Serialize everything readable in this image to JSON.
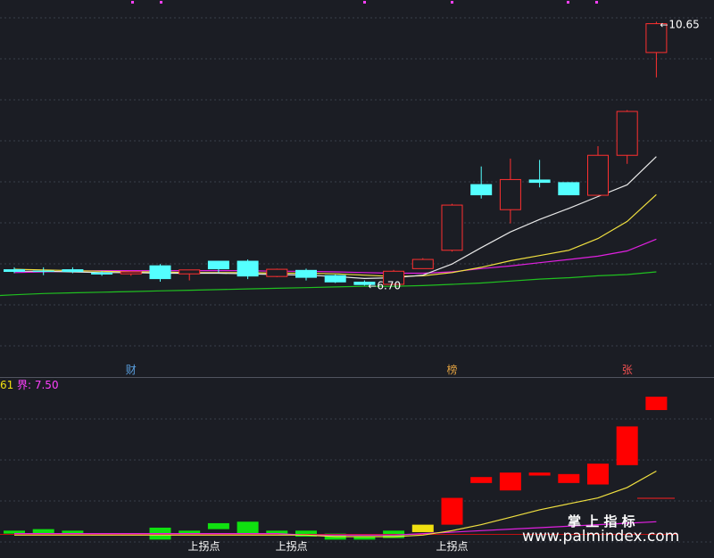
{
  "chart_data": [
    {
      "type": "candlestick",
      "title": "",
      "ylim": [
        6.0,
        10.9
      ],
      "candles": [
        {
          "o": 6.87,
          "h": 6.9,
          "l": 6.81,
          "c": 6.83
        },
        {
          "o": 6.85,
          "h": 6.9,
          "l": 6.78,
          "c": 6.83
        },
        {
          "o": 6.87,
          "h": 6.9,
          "l": 6.81,
          "c": 6.83
        },
        {
          "o": 6.82,
          "h": 6.84,
          "l": 6.77,
          "c": 6.79
        },
        {
          "o": 6.8,
          "h": 6.84,
          "l": 6.77,
          "c": 6.83
        },
        {
          "o": 6.93,
          "h": 6.95,
          "l": 6.68,
          "c": 6.72
        },
        {
          "o": 6.8,
          "h": 6.84,
          "l": 6.7,
          "c": 6.86
        },
        {
          "o": 7.0,
          "h": 7.0,
          "l": 6.82,
          "c": 6.87
        },
        {
          "o": 7.0,
          "h": 7.02,
          "l": 6.72,
          "c": 6.76
        },
        {
          "o": 6.76,
          "h": 6.88,
          "l": 6.75,
          "c": 6.87
        },
        {
          "o": 6.86,
          "h": 6.88,
          "l": 6.7,
          "c": 6.74
        },
        {
          "o": 6.78,
          "h": 6.79,
          "l": 6.66,
          "c": 6.67
        },
        {
          "o": 6.68,
          "h": 6.7,
          "l": 6.62,
          "c": 6.63
        },
        {
          "o": 6.64,
          "h": 6.86,
          "l": 6.64,
          "c": 6.84
        },
        {
          "o": 6.88,
          "h": 7.04,
          "l": 6.88,
          "c": 7.02
        },
        {
          "o": 7.16,
          "h": 7.87,
          "l": 7.14,
          "c": 7.85
        },
        {
          "o": 8.17,
          "h": 8.44,
          "l": 7.95,
          "c": 8.0
        },
        {
          "o": 7.78,
          "h": 8.56,
          "l": 7.57,
          "c": 8.24
        },
        {
          "o": 8.24,
          "h": 8.54,
          "l": 8.12,
          "c": 8.19
        },
        {
          "o": 8.2,
          "h": 8.2,
          "l": 8.0,
          "c": 8.0
        },
        {
          "o": 8.0,
          "h": 8.75,
          "l": 8.0,
          "c": 8.61
        },
        {
          "o": 8.61,
          "h": 9.3,
          "l": 8.48,
          "c": 9.28
        },
        {
          "o": 10.18,
          "h": 10.65,
          "l": 9.8,
          "c": 10.62
        }
      ],
      "ma_white": [
        6.84,
        6.84,
        6.83,
        6.82,
        6.82,
        6.81,
        6.81,
        6.81,
        6.8,
        6.79,
        6.78,
        6.76,
        6.73,
        6.74,
        6.78,
        6.95,
        7.2,
        7.44,
        7.63,
        7.8,
        7.98,
        8.16,
        8.59
      ],
      "ma_yellow": [
        6.87,
        6.86,
        6.85,
        6.84,
        6.83,
        6.83,
        6.82,
        6.82,
        6.82,
        6.81,
        6.81,
        6.8,
        6.78,
        6.76,
        6.77,
        6.82,
        6.9,
        7.0,
        7.08,
        7.16,
        7.34,
        7.6,
        8.01
      ],
      "ma_magenta": [
        6.82,
        6.83,
        6.84,
        6.85,
        6.85,
        6.85,
        6.85,
        6.85,
        6.85,
        6.84,
        6.84,
        6.83,
        6.82,
        6.81,
        6.81,
        6.83,
        6.88,
        6.92,
        6.97,
        7.02,
        7.07,
        7.15,
        7.33
      ],
      "ma_green": [
        6.48,
        6.5,
        6.51,
        6.52,
        6.53,
        6.54,
        6.55,
        6.56,
        6.57,
        6.58,
        6.59,
        6.6,
        6.61,
        6.61,
        6.62,
        6.64,
        6.66,
        6.69,
        6.72,
        6.74,
        6.77,
        6.79,
        6.83
      ],
      "price_labels": [
        {
          "index": 22,
          "value": 10.65,
          "text": "10.65"
        },
        {
          "index": 12,
          "value": 6.62,
          "text": "6.70"
        }
      ],
      "markers": [
        {
          "index": 4,
          "text": "财",
          "color": "#5aa0e0"
        },
        {
          "index": 15,
          "text": "榜",
          "color": "#e0a040"
        },
        {
          "index": 21,
          "text": "张",
          "color": "#f05050"
        }
      ]
    },
    {
      "type": "bar",
      "header_left": "61",
      "header_value": "界: 7.50",
      "ylim": [
        0,
        1
      ],
      "bars": [
        {
          "top": 0.1,
          "bottom": 0.08,
          "color": "#10e010"
        },
        {
          "top": 0.11,
          "bottom": 0.08,
          "color": "#10e010"
        },
        {
          "top": 0.1,
          "bottom": 0.08,
          "color": "#10e010"
        },
        {
          "top": 0.08,
          "bottom": 0.07,
          "color": "#10e010"
        },
        {
          "top": 0.08,
          "bottom": 0.07,
          "color": "#10e010"
        },
        {
          "top": 0.12,
          "bottom": 0.04,
          "color": "#10e010"
        },
        {
          "top": 0.1,
          "bottom": 0.08,
          "color": "#10e010"
        },
        {
          "top": 0.15,
          "bottom": 0.11,
          "color": "#10e010"
        },
        {
          "top": 0.16,
          "bottom": 0.08,
          "color": "#10e010"
        },
        {
          "top": 0.1,
          "bottom": 0.07,
          "color": "#10e010"
        },
        {
          "top": 0.1,
          "bottom": 0.06,
          "color": "#10e010"
        },
        {
          "top": 0.08,
          "bottom": 0.04,
          "color": "#10e010"
        },
        {
          "top": 0.06,
          "bottom": 0.04,
          "color": "#10e010"
        },
        {
          "top": 0.1,
          "bottom": 0.05,
          "color": "#10e010"
        },
        {
          "top": 0.14,
          "bottom": 0.09,
          "color": "#f0e010"
        },
        {
          "top": 0.32,
          "bottom": 0.14,
          "color": "#ff0000"
        },
        {
          "top": 0.46,
          "bottom": 0.42,
          "color": "#ff0000"
        },
        {
          "top": 0.49,
          "bottom": 0.37,
          "color": "#ff0000"
        },
        {
          "top": 0.49,
          "bottom": 0.47,
          "color": "#ff0000"
        },
        {
          "top": 0.48,
          "bottom": 0.42,
          "color": "#ff0000"
        },
        {
          "top": 0.55,
          "bottom": 0.41,
          "color": "#ff0000"
        },
        {
          "top": 0.8,
          "bottom": 0.54,
          "color": "#ff0000"
        },
        {
          "top": 1.0,
          "bottom": 0.91,
          "color": "#ff0000"
        }
      ],
      "yellow_line": [
        0.07,
        0.07,
        0.07,
        0.07,
        0.07,
        0.07,
        0.07,
        0.07,
        0.07,
        0.07,
        0.07,
        0.06,
        0.06,
        0.06,
        0.07,
        0.1,
        0.14,
        0.19,
        0.24,
        0.28,
        0.32,
        0.39,
        0.5
      ],
      "magenta_line": [
        0.08,
        0.08,
        0.08,
        0.08,
        0.08,
        0.08,
        0.08,
        0.08,
        0.08,
        0.08,
        0.07,
        0.07,
        0.07,
        0.07,
        0.08,
        0.09,
        0.1,
        0.11,
        0.12,
        0.13,
        0.14,
        0.15,
        0.16
      ],
      "signals": [
        {
          "index": 6.5,
          "text": "上拐点"
        },
        {
          "index": 9.5,
          "text": "上拐点"
        },
        {
          "index": 15,
          "text": "上拐点"
        }
      ],
      "watermark_cn": "掌 上 指 标",
      "watermark_url": "www.palmindex.com"
    }
  ]
}
